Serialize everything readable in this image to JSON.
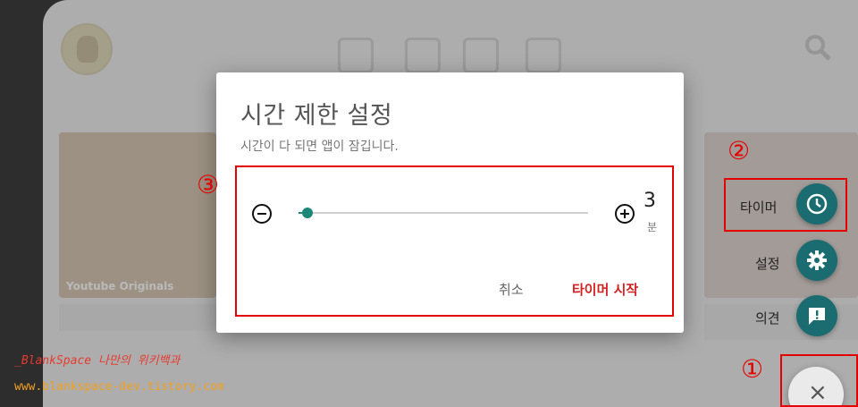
{
  "dialog": {
    "title": "시간 제한 설정",
    "subtitle": "시간이 다 되면 앱이 잠깁니다.",
    "slider_value": "3",
    "slider_fraction": 0.03,
    "unit": "분",
    "cancel_label": "취소",
    "start_label": "타이머 시작"
  },
  "fab_menu": {
    "timer_label": "타이머",
    "settings_label": "설정",
    "feedback_label": "의견",
    "close_symbol": "×"
  },
  "annotations": {
    "marker_1": "①",
    "marker_2": "②",
    "marker_3": "③"
  },
  "background": {
    "thumb_label": "Youtube Originals"
  },
  "watermark": {
    "line1": "_BlankSpace 나만의 위키백과",
    "line2": "www.blankspace-dev.tistory.com"
  },
  "colors": {
    "accent": "#1e8878",
    "fab": "#1a6c70",
    "danger": "#d42222",
    "annotation": "#e50000"
  },
  "icons": [
    "clock-icon",
    "gear-icon",
    "feedback-icon",
    "close-icon",
    "minus-circle-icon",
    "plus-circle-icon",
    "search-icon"
  ]
}
